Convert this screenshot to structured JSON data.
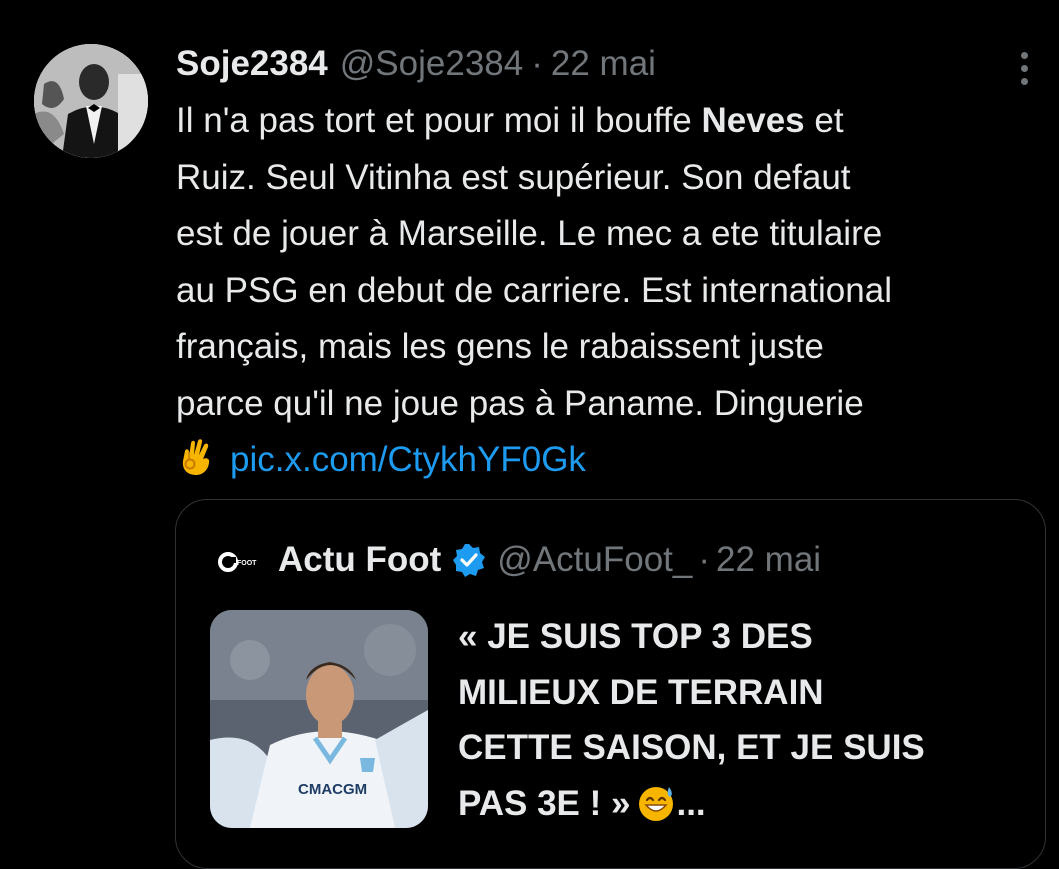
{
  "post": {
    "author_name": "Soje2384",
    "author_handle": "@Soje2384",
    "separator": "·",
    "date": "22 mai",
    "body": {
      "line1_before": "Il n'a pas tort et pour moi il bouffe ",
      "line1_bold": "Neves",
      "line1_after": " et",
      "line2": "Ruiz. Seul Vitinha est supérieur.  Son defaut",
      "line3": "est de jouer à Marseille. Le mec a ete titulaire",
      "line4": "au PSG en debut de carriere. Est international",
      "line5": "français, mais les gens le rabaissent juste",
      "line6": "parce qu'il ne joue pas à Paname. Dinguerie"
    },
    "emoji_icon": "ok-hand-emoji-icon",
    "link_text": "pic.x.com/CtykhYF0Gk"
  },
  "quote": {
    "logo_text": "FOOT",
    "name": "Actu Foot",
    "verified_icon": "verified-badge-icon",
    "handle": "@ActuFoot_",
    "separator": "·",
    "date": "22 mai",
    "text_line1": "« JE SUIS TOP 3 DES",
    "text_line2": "MILIEUX DE TERRAIN",
    "text_line3": "CETTE SAISON, ET JE SUIS",
    "text_line4": "PAS 3E ! »",
    "text_ellipsis": "...",
    "emoji_icon": "grinning-sweat-emoji-icon",
    "shirt_sponsor": "CMACGM"
  },
  "colors": {
    "background": "#000000",
    "text_primary": "#e7e9ea",
    "text_secondary": "#71767b",
    "link": "#1d9bf0",
    "border": "#2f3336"
  }
}
